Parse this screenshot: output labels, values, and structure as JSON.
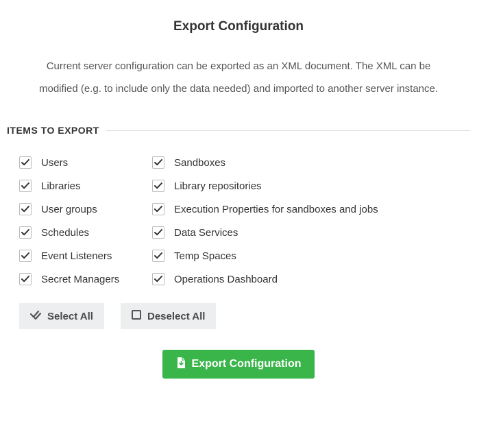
{
  "title": "Export Configuration",
  "description": "Current server configuration can be exported as an XML document. The XML can be modified (e.g. to include only the data needed) and imported to another server instance.",
  "section_header": "ITEMS TO EXPORT",
  "items_col1": [
    {
      "label": "Users",
      "checked": true
    },
    {
      "label": "Libraries",
      "checked": true
    },
    {
      "label": "User groups",
      "checked": true
    },
    {
      "label": "Schedules",
      "checked": true
    },
    {
      "label": "Event Listeners",
      "checked": true
    },
    {
      "label": "Secret Managers",
      "checked": true
    }
  ],
  "items_col2": [
    {
      "label": "Sandboxes",
      "checked": true
    },
    {
      "label": "Library repositories",
      "checked": true
    },
    {
      "label": "Execution Properties for sandboxes and jobs",
      "checked": true
    },
    {
      "label": "Data Services",
      "checked": true
    },
    {
      "label": "Temp Spaces",
      "checked": true
    },
    {
      "label": "Operations Dashboard",
      "checked": true
    }
  ],
  "buttons": {
    "select_all": "Select All",
    "deselect_all": "Deselect All",
    "export": "Export Configuration"
  }
}
